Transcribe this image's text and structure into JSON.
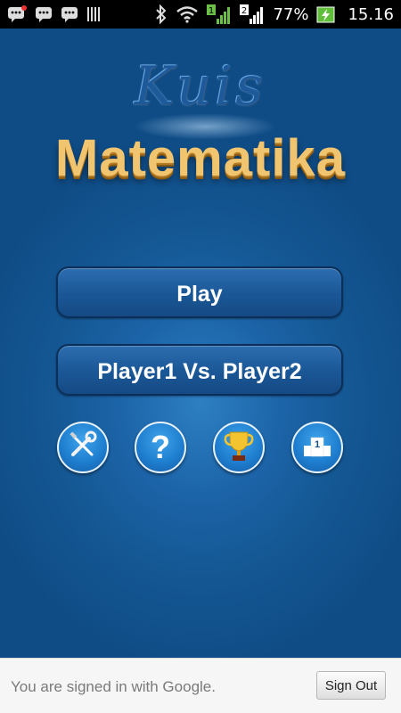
{
  "status_bar": {
    "left_icons": [
      "bbm-notification-icon",
      "bbm-icon",
      "bbm-icon",
      "barcode-icon"
    ],
    "battery_percent": "77%",
    "time": "15.16",
    "sim1_label": "1",
    "sim2_label": "2"
  },
  "logo": {
    "line1": "Kuis",
    "line2": "Matematika"
  },
  "menu": {
    "play_label": "Play",
    "pvp_label": "Player1 Vs. Player2"
  },
  "icon_buttons": [
    {
      "name": "settings-icon"
    },
    {
      "name": "help-icon",
      "glyph": "?"
    },
    {
      "name": "trophy-icon"
    },
    {
      "name": "leaderboard-icon",
      "badge": "1"
    }
  ],
  "footer": {
    "signed_in_text": "You are signed in with Google.",
    "sign_out_label": "Sign Out"
  },
  "colors": {
    "background": "#145793",
    "logo_gold": "#f1c46f",
    "button_blue": "#1b5898"
  }
}
